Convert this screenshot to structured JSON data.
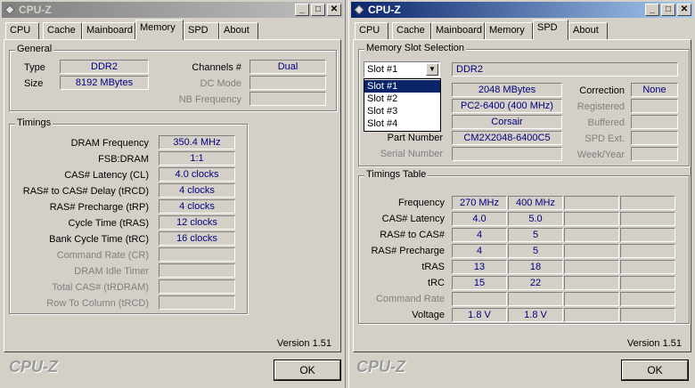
{
  "app_title": "CPU-Z",
  "tabs": [
    "CPU",
    "Cache",
    "Mainboard",
    "Memory",
    "SPD",
    "About"
  ],
  "memory": {
    "general_title": "General",
    "type_label": "Type",
    "type_value": "DDR2",
    "size_label": "Size",
    "size_value": "8192 MBytes",
    "channels_label": "Channels #",
    "channels_value": "Dual",
    "dcmode_label": "DC Mode",
    "dcmode_value": "",
    "nbfreq_label": "NB Frequency",
    "nbfreq_value": "",
    "timings_title": "Timings",
    "timings": [
      {
        "label": "DRAM Frequency",
        "value": "350.4 MHz",
        "enabled": true
      },
      {
        "label": "FSB:DRAM",
        "value": "1:1",
        "enabled": true
      },
      {
        "label": "CAS# Latency (CL)",
        "value": "4.0 clocks",
        "enabled": true
      },
      {
        "label": "RAS# to CAS# Delay (tRCD)",
        "value": "4 clocks",
        "enabled": true
      },
      {
        "label": "RAS# Precharge (tRP)",
        "value": "4 clocks",
        "enabled": true
      },
      {
        "label": "Cycle Time (tRAS)",
        "value": "12 clocks",
        "enabled": true
      },
      {
        "label": "Bank Cycle Time (tRC)",
        "value": "16 clocks",
        "enabled": true
      },
      {
        "label": "Command Rate (CR)",
        "value": "",
        "enabled": false
      },
      {
        "label": "DRAM Idle Timer",
        "value": "",
        "enabled": false
      },
      {
        "label": "Total CAS# (tRDRAM)",
        "value": "",
        "enabled": false
      },
      {
        "label": "Row To Column (tRCD)",
        "value": "",
        "enabled": false
      }
    ]
  },
  "spd": {
    "slot_title": "Memory Slot Selection",
    "slot_selected": "Slot #1",
    "slot_options": [
      "Slot #1",
      "Slot #2",
      "Slot #3",
      "Slot #4"
    ],
    "mem_type": "DDR2",
    "module_size": "2048 MBytes",
    "max_bandwidth": "PC2-6400 (400 MHz)",
    "manufacturer": "Corsair",
    "part_number_label": "Part Number",
    "part_number": "CM2X2048-6400C5",
    "serial_label": "Serial Number",
    "serial": "",
    "correction_label": "Correction",
    "correction": "None",
    "registered_label": "Registered",
    "buffered_label": "Buffered",
    "spdext_label": "SPD Ext.",
    "weekyear_label": "Week/Year",
    "timings_title": "Timings Table",
    "table": [
      {
        "label": "Frequency",
        "v1": "270 MHz",
        "v2": "400 MHz",
        "enabled": true
      },
      {
        "label": "CAS# Latency",
        "v1": "4.0",
        "v2": "5.0",
        "enabled": true
      },
      {
        "label": "RAS# to CAS#",
        "v1": "4",
        "v2": "5",
        "enabled": true
      },
      {
        "label": "RAS# Precharge",
        "v1": "4",
        "v2": "5",
        "enabled": true
      },
      {
        "label": "tRAS",
        "v1": "13",
        "v2": "18",
        "enabled": true
      },
      {
        "label": "tRC",
        "v1": "15",
        "v2": "22",
        "enabled": true
      },
      {
        "label": "Command Rate",
        "v1": "",
        "v2": "",
        "enabled": false
      },
      {
        "label": "Voltage",
        "v1": "1.8 V",
        "v2": "1.8 V",
        "enabled": true
      }
    ]
  },
  "version": "Version 1.51",
  "brand": "CPU-Z",
  "ok_label": "OK"
}
